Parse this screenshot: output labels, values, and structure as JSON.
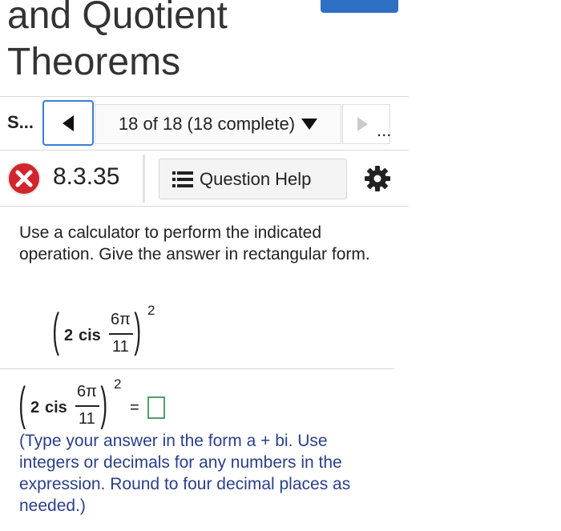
{
  "header": {
    "title_line1": "and Quotient",
    "title_line2": "Theorems"
  },
  "nav": {
    "section_label": "S...",
    "status": "18 of 18 (18 complete)",
    "next_dots": "..."
  },
  "question": {
    "number": "8.3.35",
    "help_label": "Question Help",
    "instruction": "Use a calculator to perform the indicated operation. Give the answer in rectangular form.",
    "expression": {
      "coefficient": "2",
      "function": "cis",
      "numerator": "6π",
      "denominator": "11",
      "exponent": "2"
    },
    "answer_equals": "=",
    "answer_value": "",
    "hint": "(Type your answer in the form a + bi. Use integers or decimals for any numbers in the expression. Round to four decimal places as needed.)"
  },
  "colors": {
    "accent": "#3b7dd8",
    "error": "#d0252c",
    "hint_text": "#2a3f8a",
    "answer_border": "#4ea06a"
  },
  "icons": {
    "prev": "triangle-left-icon",
    "dropdown": "triangle-down-icon",
    "next": "triangle-right-icon",
    "incorrect": "x-circle-icon",
    "help": "list-icon",
    "settings": "gear-icon"
  }
}
